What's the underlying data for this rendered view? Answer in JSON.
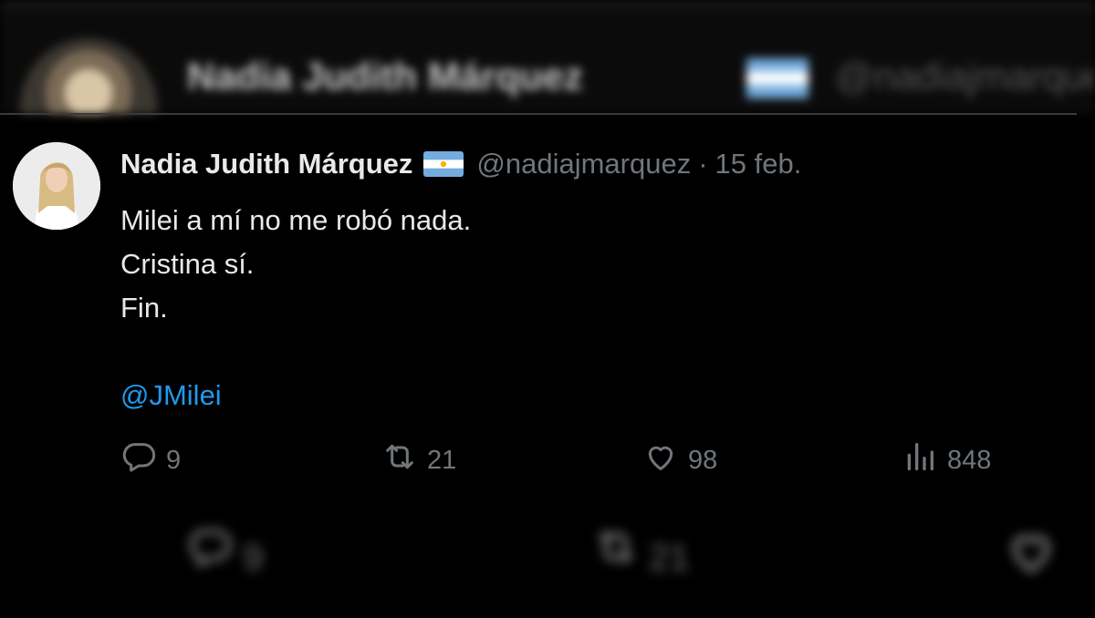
{
  "background": {
    "name": "Nadia Judith Márquez",
    "handle": "@nadiajmarquez"
  },
  "tweet": {
    "author_name": "Nadia Judith Márquez",
    "handle": "@nadiajmarquez",
    "separator": "·",
    "date": "15 feb.",
    "lines": [
      "Milei a mí no me robó nada.",
      "Cristina sí.",
      "Fin."
    ],
    "mention": "@JMilei"
  },
  "actions": {
    "replies": "9",
    "retweets": "21",
    "likes": "98",
    "views": "848"
  },
  "footer": {
    "replies": "9",
    "retweets": "21"
  },
  "colors": {
    "background": "#000000",
    "text": "#e7e9ea",
    "muted": "#71767b",
    "mention": "#1d9bf0"
  },
  "icons": [
    "reply-icon",
    "retweet-icon",
    "like-icon",
    "views-icon",
    "argentina-flag-icon"
  ]
}
